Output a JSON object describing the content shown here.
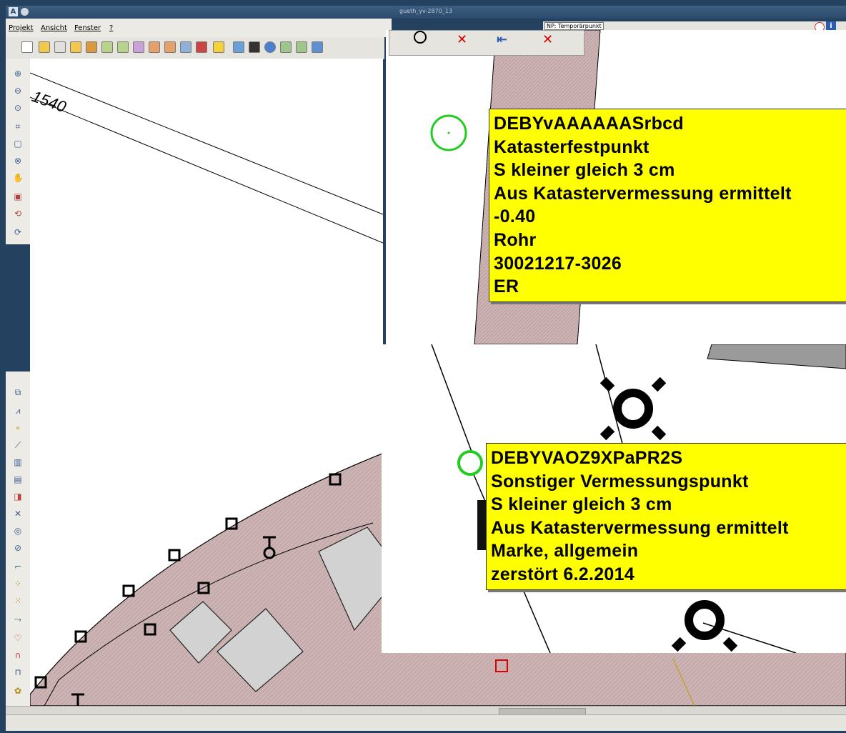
{
  "window": {
    "title": "gueth_yv-2870_13",
    "app_icon_letter": "A"
  },
  "menu": [
    "Projekt",
    "Ansicht",
    "Fenster",
    "?"
  ],
  "np_bar": {
    "label": "NP: Temporärpunkt"
  },
  "map": {
    "parcel_number": "1540"
  },
  "tooltips": [
    {
      "lines": [
        "DEBYvAAAAAASrbcd",
        "Katasterfestpunkt",
        "S kleiner gleich 3 cm",
        "Aus Katastervermessung ermittelt",
        "-0.40",
        "Rohr",
        "30021217-3026",
        "ER"
      ]
    },
    {
      "lines": [
        "DEBYVAOZ9XPaPR2S",
        "Sonstiger Vermessungspunkt",
        "S kleiner gleich 3 cm",
        "Aus Katastervermessung ermittelt",
        "Marke, allgemein",
        "zerstört 6.2.2014"
      ]
    }
  ],
  "colors": {
    "parcel_fill": "#cdb3b3",
    "building_fill": "#d2d2d2",
    "tooltip_bg": "#ffff00",
    "marker_green": "#22cc22",
    "desktop": "#24415f"
  }
}
